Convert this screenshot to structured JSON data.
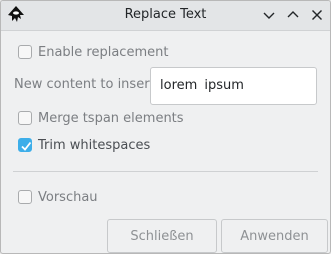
{
  "window": {
    "title": "Replace Text",
    "icon": "inkscape-logo-icon",
    "controls": [
      "minimize-icon",
      "maximize-icon",
      "close-icon"
    ]
  },
  "form": {
    "enable_replacement": {
      "label": "Enable replacement",
      "checked": false
    },
    "new_content": {
      "label": "New content to insert",
      "value": "lorem  ipsum"
    },
    "merge_tspan": {
      "label": "Merge tspan elements",
      "checked": false
    },
    "trim_whitespaces": {
      "label": "Trim whitespaces",
      "checked": true
    },
    "preview": {
      "label": "Vorschau",
      "checked": false
    }
  },
  "buttons": {
    "close_label": "Schließen",
    "apply_label": "Anwenden"
  },
  "colors": {
    "accent": "#3daee9",
    "window_bg": "#eff0f1",
    "titlebar_bg": "#e3e5e7"
  }
}
